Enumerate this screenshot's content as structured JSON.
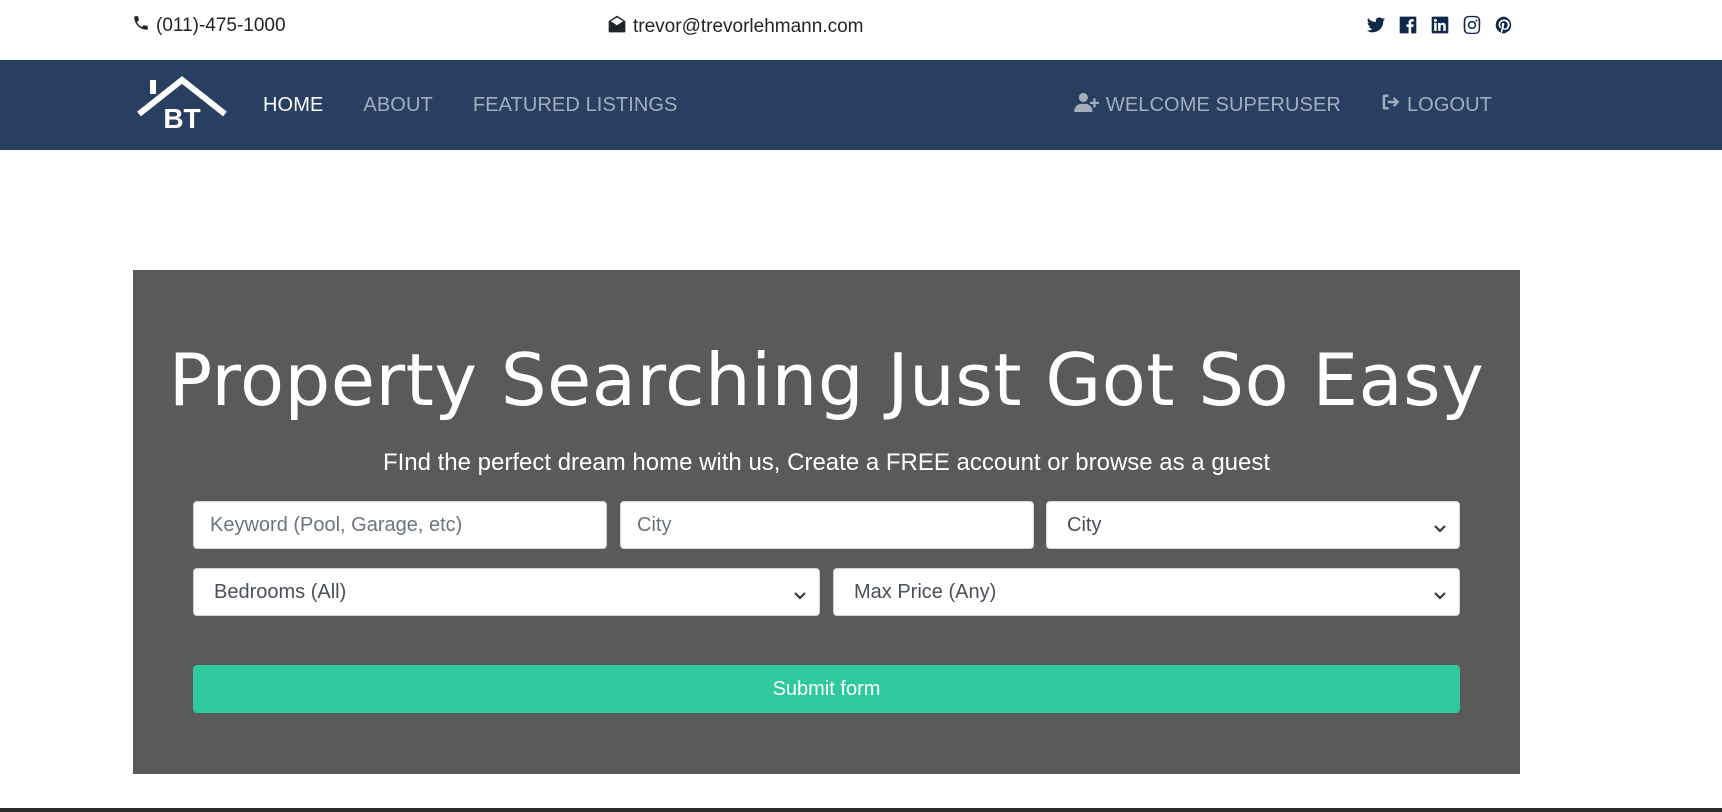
{
  "topbar": {
    "phone": "(011)-475-1000",
    "email": "trevor@trevorlehmann.com",
    "social": [
      "twitter-icon",
      "facebook-icon",
      "linkedin-icon",
      "instagram-icon",
      "pinterest-icon"
    ]
  },
  "navbar": {
    "logo_text": "BT",
    "links": [
      {
        "label": "HOME",
        "active": true
      },
      {
        "label": "ABOUT",
        "active": false
      },
      {
        "label": "FEATURED LISTINGS",
        "active": false
      }
    ],
    "right_links": [
      {
        "label": "WELCOME SUPERUSER",
        "icon": "user-plus-icon"
      },
      {
        "label": "LOGOUT",
        "icon": "sign-out-icon"
      }
    ]
  },
  "showcase": {
    "title": "Property Searching Just Got So Easy",
    "lead": "FInd the perfect dream home with us, Create a FREE account or browse as a guest",
    "keyword_placeholder": "Keyword (Pool, Garage, etc)",
    "city_placeholder": "City",
    "state_select": "City",
    "bedrooms_select": "Bedrooms (All)",
    "price_select": "Max Price (Any)",
    "submit_label": "Submit form"
  },
  "colors": {
    "navbar": "#293f61",
    "showcase": "#5a5a5a",
    "submit": "#2ec99e",
    "social_icon": "#10284a"
  }
}
